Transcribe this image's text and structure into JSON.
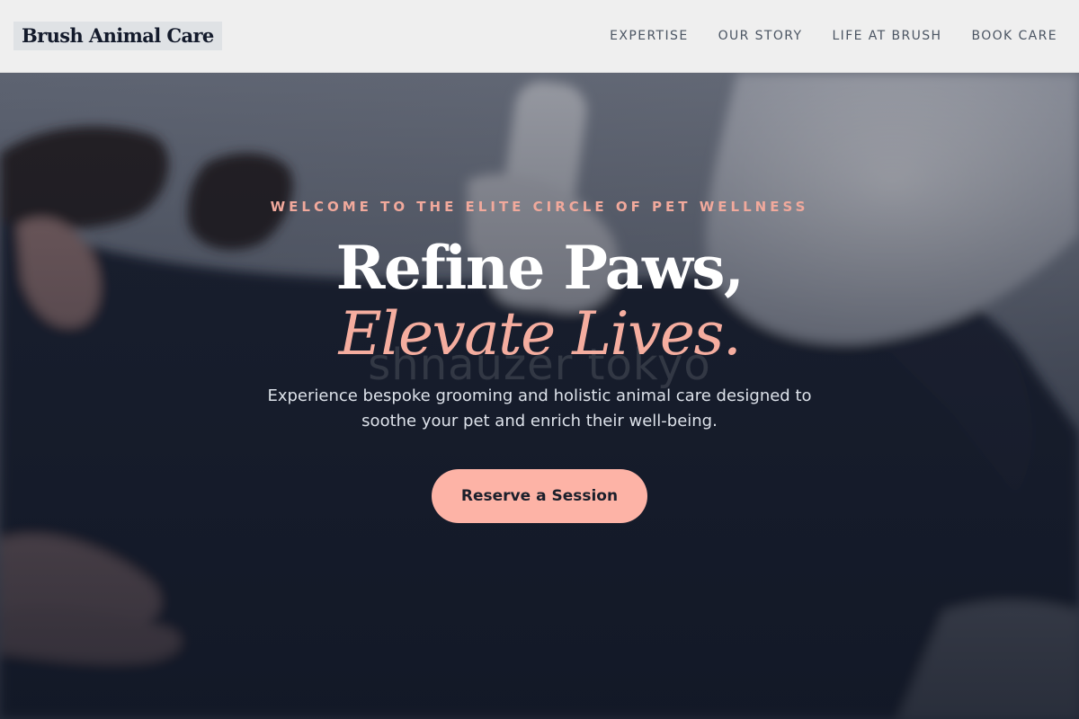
{
  "header": {
    "logo": "Brush Animal Care",
    "nav": [
      {
        "label": "EXPERTISE"
      },
      {
        "label": "OUR STORY"
      },
      {
        "label": "LIFE AT BRUSH"
      },
      {
        "label": "BOOK CARE"
      }
    ]
  },
  "hero": {
    "eyebrow": "WELCOME TO THE ELITE CIRCLE OF PET WELLNESS",
    "title_line1": "Refine Paws,",
    "title_line2": "Elevate Lives.",
    "subtitle": "Experience bespoke grooming and holistic animal care designed to soothe your pet and enrich their well-being.",
    "watermark": "shnauzer tokyo",
    "cta_label": "Reserve a Session"
  },
  "colors": {
    "accent": "#fdb3a6",
    "accent_text": "#f1a99c",
    "header_bg": "#efefef",
    "logo_text": "#131a2b",
    "nav_text": "#4b5563"
  }
}
